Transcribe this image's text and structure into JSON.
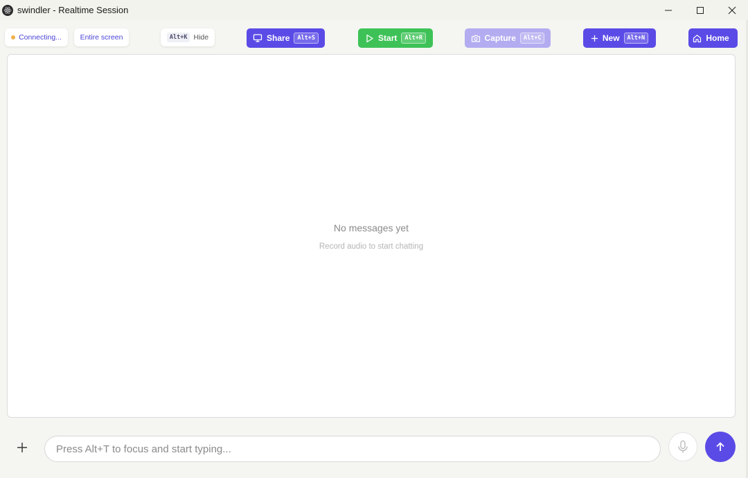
{
  "window": {
    "title": "swindler - Realtime Session",
    "app_icon": "electron-icon"
  },
  "toolbar": {
    "status_label": "Connecting...",
    "status_color": "#f0b04a",
    "screen_source": "Entire screen",
    "hide_shortcut": "Alt+K",
    "hide_label": "Hide",
    "share_label": "Share",
    "share_shortcut": "Alt+S",
    "start_label": "Start",
    "start_shortcut": "Alt+R",
    "capture_label": "Capture",
    "capture_shortcut": "Alt+C",
    "new_label": "New",
    "new_shortcut": "Alt+N",
    "home_label": "Home"
  },
  "chat": {
    "empty_title": "No messages yet",
    "empty_subtitle": "Record audio to start chatting"
  },
  "composer": {
    "placeholder": "Press Alt+T to focus and start typing...",
    "value": ""
  },
  "colors": {
    "accent": "#5b4be6",
    "start_green": "#3ec257",
    "capture_disabled": "#b3acf0"
  }
}
